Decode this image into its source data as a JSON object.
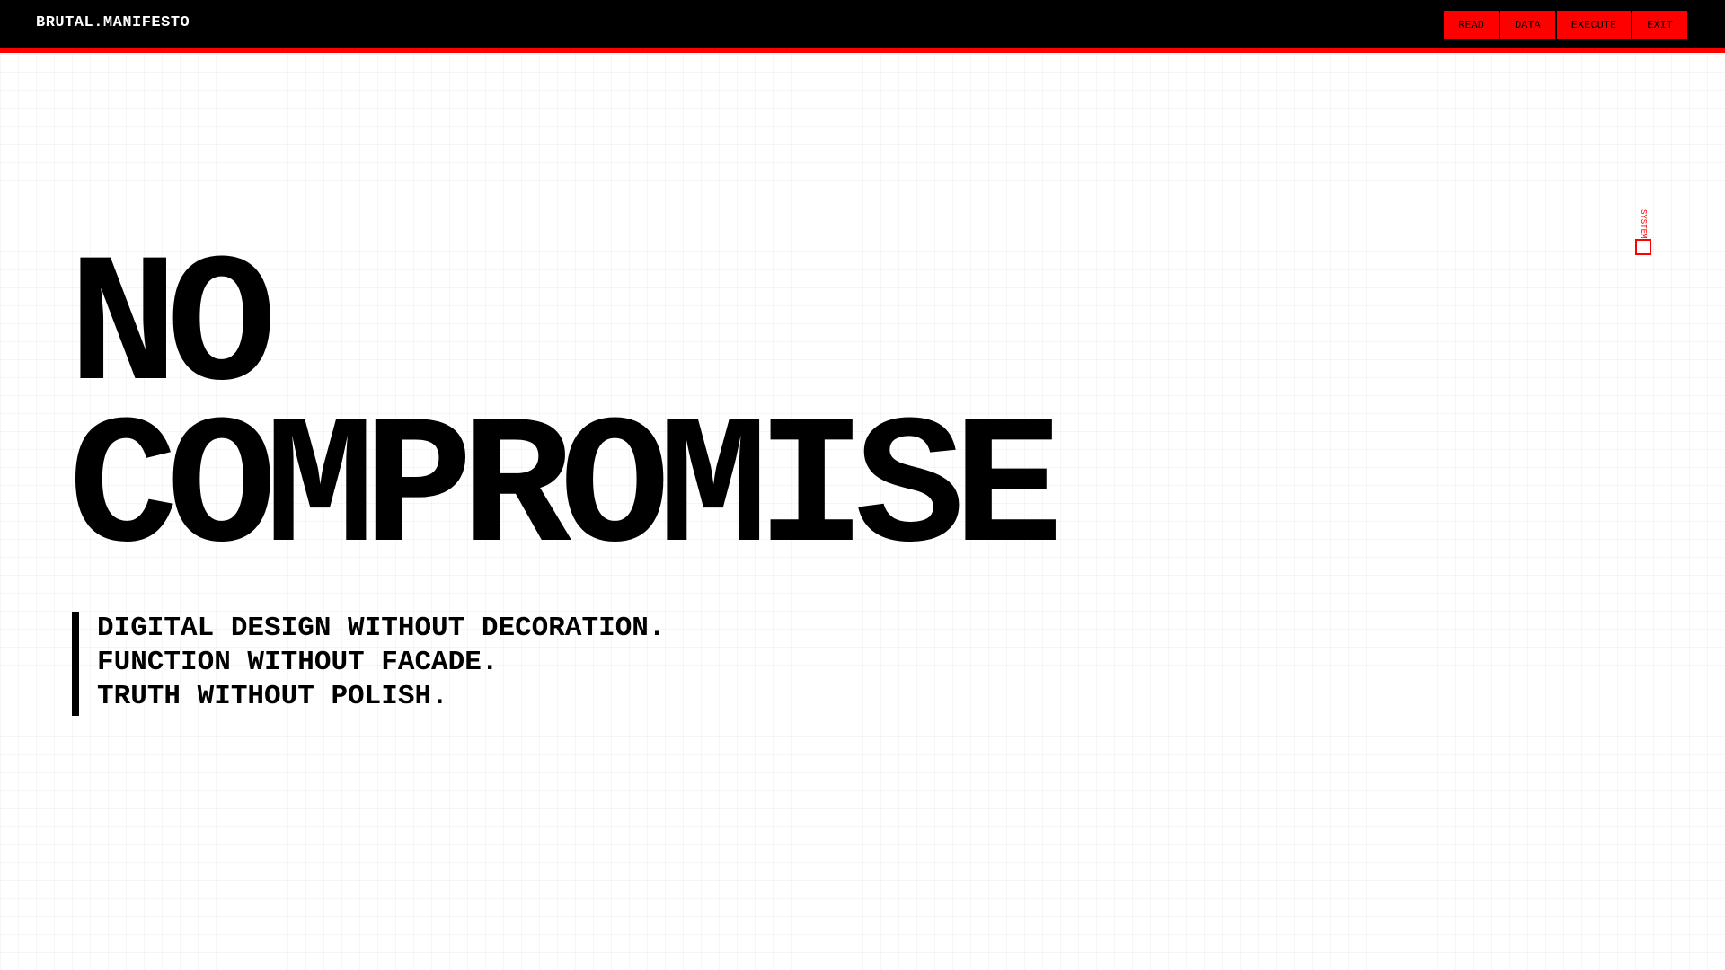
{
  "header": {
    "brand": "BRUTAL.MANIFESTO",
    "nav": [
      {
        "label": "READ"
      },
      {
        "label": "DATA"
      },
      {
        "label": "EXECUTE"
      },
      {
        "label": "EXIT"
      }
    ]
  },
  "hero": {
    "title_line1": "NO",
    "title_line2": "COMPROMISE",
    "tagline": [
      "DIGITAL DESIGN WITHOUT DECORATION.",
      "FUNCTION WITHOUT FACADE.",
      "TRUTH WITHOUT POLISH."
    ]
  },
  "side_marker": {
    "text": "SYSTEM"
  },
  "colors": {
    "accent": "#ff0000",
    "bar": "#000000",
    "background": "#ffffff"
  }
}
